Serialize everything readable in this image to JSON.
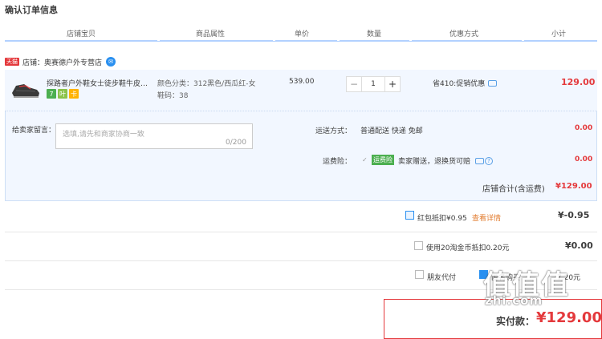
{
  "page": {
    "title": "确认订单信息"
  },
  "columns": [
    "店铺宝贝",
    "商品属性",
    "单价",
    "数量",
    "优惠方式",
    "小计"
  ],
  "shop": {
    "badge": "天猫",
    "label": "店铺：",
    "name": "奥赛德户外专营店"
  },
  "item": {
    "name": "探路者户外鞋女士徒步鞋牛皮耐磨防滑登山鞋",
    "badges": [
      "7",
      "叶",
      "卡"
    ],
    "attr_color": "颜色分类：312黑色/西瓜红-女",
    "attr_size": "鞋码：38",
    "unit_price": "539.00",
    "quantity": "1",
    "qty_minus": "−",
    "qty_plus": "+",
    "promotion": "省410:促销优惠",
    "subtotal": "129.00"
  },
  "message": {
    "label": "给卖家留言：",
    "placeholder": "选填,请先和商家协商一致",
    "counter": "0/200"
  },
  "shipping": {
    "label": "运送方式：",
    "value": "普通配送 快递 免邮",
    "fee": "0.00"
  },
  "insurance": {
    "label": "运费险：",
    "check": "✓",
    "tag": "运费险",
    "desc": "卖家赠送，退换货可赔",
    "help": "?",
    "fee": "0.00"
  },
  "shop_total": {
    "label": "店铺合计(含运费)",
    "value": "¥129.00"
  },
  "redpacket": {
    "label": "红包抵扣¥0.95",
    "link": "查看详情",
    "value": "¥-0.95",
    "checked": true
  },
  "taojinbi": {
    "label": "使用20淘金币抵扣0.20元",
    "value": "¥0.00",
    "checked": false
  },
  "friend_pay": {
    "label": "朋友代付",
    "anon_label": "匿名购买",
    "extra_label": "7.20元"
  },
  "payment": {
    "label": "实付款：",
    "value": "¥129.00"
  },
  "watermark": {
    "logo": "值值值",
    "url": "zhi.com"
  },
  "colors": {
    "accent": "#e4393c",
    "blue": "#2a90f0",
    "header_line": "#b2d1ff",
    "item_bg": "#f2f7ff"
  }
}
